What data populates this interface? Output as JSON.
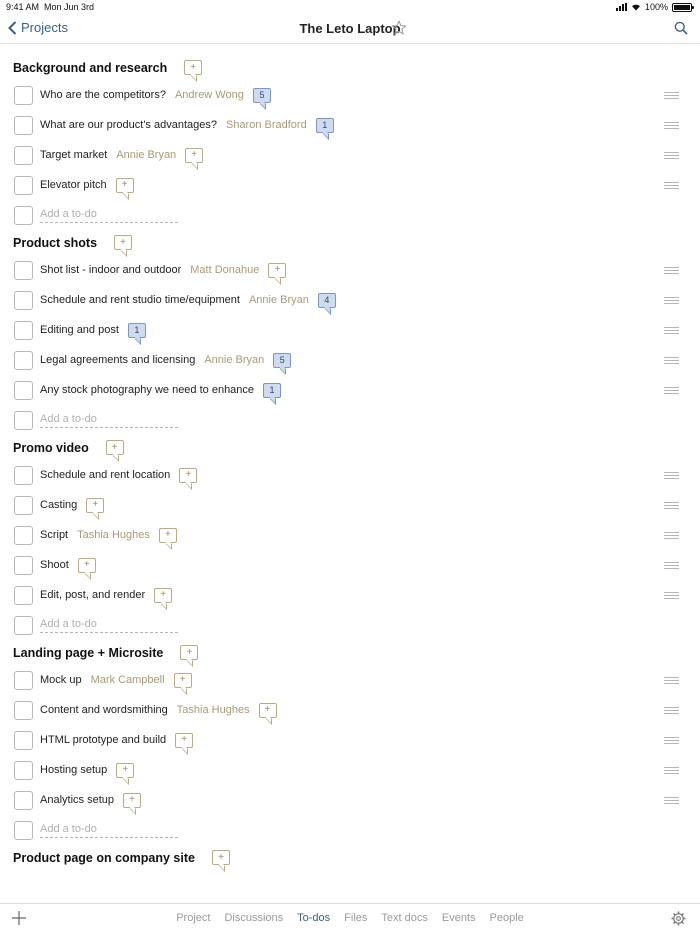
{
  "status": {
    "time": "9:41 AM",
    "date": "Mon Jun 3rd",
    "battery": "100%"
  },
  "nav": {
    "back_label": "Projects",
    "title": "The Leto Laptop"
  },
  "sections": [
    {
      "title": "Background and research",
      "todos": [
        {
          "text": "Who are the competitors?",
          "assignee": "Andrew Wong",
          "comments": "5"
        },
        {
          "text": "What are our product's advantages?",
          "assignee": "Sharon Bradford",
          "comments": "1"
        },
        {
          "text": "Target market",
          "assignee": "Annie Bryan",
          "comments": ""
        },
        {
          "text": "Elevator pitch",
          "assignee": "",
          "comments": ""
        }
      ]
    },
    {
      "title": "Product shots",
      "todos": [
        {
          "text": "Shot list - indoor and outdoor",
          "assignee": "Matt Donahue",
          "comments": ""
        },
        {
          "text": "Schedule and rent studio time/equipment",
          "assignee": "Annie Bryan",
          "comments": "4"
        },
        {
          "text": "Editing and post",
          "assignee": "",
          "comments": "1"
        },
        {
          "text": "Legal agreements and licensing",
          "assignee": "Annie Bryan",
          "comments": "5"
        },
        {
          "text": "Any stock photography we need to enhance",
          "assignee": "",
          "comments": "1"
        }
      ]
    },
    {
      "title": "Promo video",
      "todos": [
        {
          "text": "Schedule and rent location",
          "assignee": "",
          "comments": ""
        },
        {
          "text": "Casting",
          "assignee": "",
          "comments": ""
        },
        {
          "text": "Script",
          "assignee": "Tashia Hughes",
          "comments": ""
        },
        {
          "text": "Shoot",
          "assignee": "",
          "comments": ""
        },
        {
          "text": "Edit, post, and render",
          "assignee": "",
          "comments": ""
        }
      ]
    },
    {
      "title": "Landing page + Microsite",
      "todos": [
        {
          "text": "Mock up",
          "assignee": "Mark Campbell",
          "comments": ""
        },
        {
          "text": "Content and wordsmithing",
          "assignee": "Tashia Hughes",
          "comments": ""
        },
        {
          "text": "HTML prototype and build",
          "assignee": "",
          "comments": ""
        },
        {
          "text": "Hosting setup",
          "assignee": "",
          "comments": ""
        },
        {
          "text": "Analytics setup",
          "assignee": "",
          "comments": ""
        }
      ]
    },
    {
      "title": "Product page on company site",
      "todos": []
    }
  ],
  "add_todo_placeholder": "Add a to-do",
  "add_comment_label": "+",
  "tabs": [
    "Project",
    "Discussions",
    "To-dos",
    "Files",
    "Text docs",
    "Events",
    "People"
  ],
  "active_tab": "To-dos",
  "colors": {
    "accent": "#3b5f86",
    "assignee": "#a89a78",
    "comment_count_bg": "#cfdcef"
  }
}
